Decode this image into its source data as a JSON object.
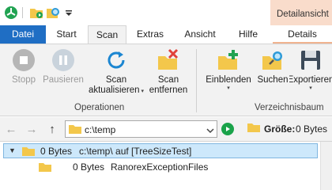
{
  "titlebar": {
    "context_tab_header": "Detailansicht",
    "quick_access_icons": [
      "treesize-logo-icon",
      "scan-folder-icon",
      "search-magnifier-icon",
      "customize-toolbar-dropdown-icon"
    ]
  },
  "tabs": [
    "Datei",
    "Start",
    "Scan",
    "Extras",
    "Ansicht",
    "Hilfe",
    "Details"
  ],
  "active_tab": "Scan",
  "ribbon": {
    "group_operationen": "Operationen",
    "group_verzeichnisbaum": "Verzeichnisbaum",
    "stop": "Stopp",
    "pause": "Pausieren",
    "refresh_line1": "Scan",
    "refresh_line2": "aktualisieren",
    "remove_line1": "Scan",
    "remove_line2": "entfernen",
    "expand": "Einblenden",
    "search": "Suchen",
    "export": "Exportieren"
  },
  "address": {
    "path": "c:\\temp",
    "size_label": "Größe:",
    "size_value": "0 Bytes"
  },
  "tree": {
    "rows": [
      {
        "size": "0 Bytes",
        "name": "c:\\temp\\  auf  [TreeSizeTest]"
      },
      {
        "size": "0 Bytes",
        "name": "RanorexExceptionFiles"
      }
    ]
  },
  "colors": {
    "file_tab": "#1f6ec4",
    "context_tab": "#f9dccb",
    "selection": "#cde8fb",
    "folder": "#f3c74b",
    "go_button": "#1aa34a"
  }
}
